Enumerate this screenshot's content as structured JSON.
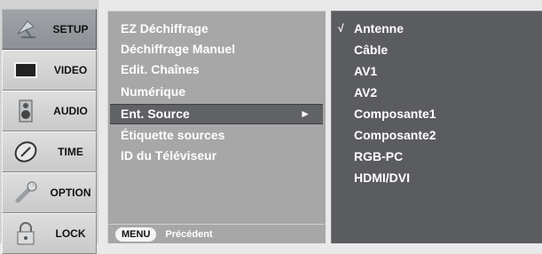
{
  "nav": {
    "items": [
      {
        "label": "SETUP",
        "icon": "satellite-dish-icon",
        "active": true
      },
      {
        "label": "VIDEO",
        "icon": "monitor-icon",
        "active": false
      },
      {
        "label": "AUDIO",
        "icon": "speaker-icon",
        "active": false
      },
      {
        "label": "TIME",
        "icon": "clock-icon",
        "active": false
      },
      {
        "label": "OPTION",
        "icon": "wrench-icon",
        "active": false
      },
      {
        "label": "LOCK",
        "icon": "padlock-icon",
        "active": false
      }
    ]
  },
  "menu": {
    "items": [
      {
        "label": "EZ Déchiffrage"
      },
      {
        "label": "Déchiffrage Manuel"
      },
      {
        "label": "Edit. Chaînes"
      },
      {
        "label": "Numérique"
      },
      {
        "label": "Ent. Source",
        "arrow": "►",
        "selected": true
      },
      {
        "label": "Étiquette sources"
      },
      {
        "label": "ID du Téléviseur"
      }
    ],
    "footer": {
      "key_label": "MENU",
      "action_label": "Précédent"
    }
  },
  "options": {
    "check_mark": "√",
    "items": [
      {
        "label": "Antenne",
        "checked": true
      },
      {
        "label": "Câble"
      },
      {
        "label": "AV1"
      },
      {
        "label": "AV2"
      },
      {
        "label": "Composante1"
      },
      {
        "label": "Composante2"
      },
      {
        "label": "RGB-PC"
      },
      {
        "label": "HDMI/DVI"
      }
    ]
  },
  "colors": {
    "nav_active": "#8d9196",
    "menu_panel": "#a7a7a7",
    "menu_selected": "#606266",
    "options_panel": "#5a5c60"
  }
}
